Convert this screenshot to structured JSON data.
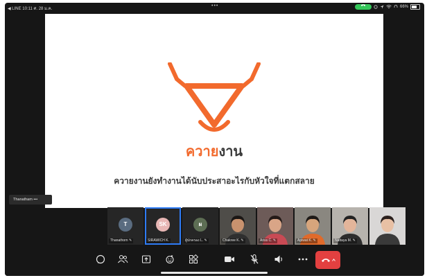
{
  "status_bar": {
    "back_app": "◀ LINE",
    "time": "10:11",
    "date": "ศ. 28 ม.ค.",
    "dots": "•••",
    "battery_text": "66%",
    "battery_level": 0.66
  },
  "slide": {
    "brand_part1": "ควาย",
    "brand_part2": "งาน",
    "tagline": "ควายงานยังทำงานได้นับประสาอะไรกับหัวใจที่แตกสลาย",
    "logo_color": "#f26a2d"
  },
  "speaker_label": "Thanatham •••",
  "participants": [
    {
      "initial": "T",
      "name": "Thanathorn ✎",
      "avatar_color": "#5a6c80",
      "has_video": false,
      "active": false
    },
    {
      "initial": "SK",
      "name": "SIRAWICH K.",
      "avatar_color": "#e7b6b4",
      "has_video": false,
      "active": true
    },
    {
      "initial": "ผ",
      "name": "ผู้ปกครอง L. ✎",
      "avatar_color": "#5d6e54",
      "has_video": false,
      "active": false
    },
    {
      "initial": "",
      "name": "Chakree K. ✎",
      "has_video": true,
      "active": false
    },
    {
      "initial": "",
      "name": "Ariss C. ✎",
      "has_video": true,
      "active": false
    },
    {
      "initial": "",
      "name": "Apiwat K. ✎",
      "has_video": true,
      "active": false
    },
    {
      "initial": "",
      "name": "Nattaya M. ✎",
      "has_video": true,
      "active": false
    },
    {
      "initial": "",
      "name": "",
      "has_video": true,
      "active": false
    }
  ],
  "toolbar": {
    "items": [
      "chat-icon",
      "participants-icon",
      "share-screen-icon",
      "reactions-icon",
      "apps-icon",
      "video-icon",
      "mic-muted-icon",
      "speaker-icon",
      "more-icon"
    ],
    "leave_color": "#e34040"
  }
}
